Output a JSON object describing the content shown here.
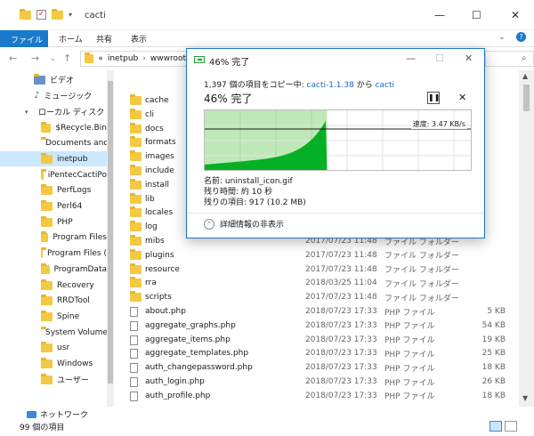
{
  "window": {
    "title": "cacti"
  },
  "ribbon": {
    "tabs": [
      "ファイル",
      "ホーム",
      "共有",
      "表示"
    ]
  },
  "address": {
    "sep": "«",
    "segments": [
      "inetpub",
      "wwwroot"
    ]
  },
  "sidebar": {
    "items": [
      {
        "label": "ビデオ",
        "icon": "video-folder-icon"
      },
      {
        "label": "ミュージック",
        "icon": "music-icon"
      },
      {
        "label": "ローカル ディスク (C",
        "icon": "drive-icon"
      },
      {
        "label": "$Recycle.Bin",
        "icon": "folder-icon"
      },
      {
        "label": "Documents and",
        "icon": "folder-icon"
      },
      {
        "label": "inetpub",
        "icon": "folder-icon"
      },
      {
        "label": "iPentecCactiPo",
        "icon": "folder-icon"
      },
      {
        "label": "PerfLogs",
        "icon": "folder-icon"
      },
      {
        "label": "Perl64",
        "icon": "folder-icon"
      },
      {
        "label": "PHP",
        "icon": "folder-icon"
      },
      {
        "label": "Program Files",
        "icon": "folder-icon"
      },
      {
        "label": "Program Files (",
        "icon": "folder-icon"
      },
      {
        "label": "ProgramData",
        "icon": "folder-icon"
      },
      {
        "label": "Recovery",
        "icon": "folder-icon"
      },
      {
        "label": "RRDTool",
        "icon": "folder-icon"
      },
      {
        "label": "Spine",
        "icon": "folder-icon"
      },
      {
        "label": "System Volume",
        "icon": "folder-icon"
      },
      {
        "label": "usr",
        "icon": "folder-icon"
      },
      {
        "label": "Windows",
        "icon": "folder-icon"
      },
      {
        "label": "ユーザー",
        "icon": "folder-icon"
      }
    ],
    "selected": "inetpub"
  },
  "files": [
    {
      "name": "cache",
      "date": "",
      "type": "",
      "size": "",
      "kind": "folder"
    },
    {
      "name": "cli",
      "date": "",
      "type": "",
      "size": "",
      "kind": "folder"
    },
    {
      "name": "docs",
      "date": "",
      "type": "",
      "size": "",
      "kind": "folder"
    },
    {
      "name": "formats",
      "date": "",
      "type": "",
      "size": "",
      "kind": "folder"
    },
    {
      "name": "images",
      "date": "",
      "type": "",
      "size": "",
      "kind": "folder"
    },
    {
      "name": "include",
      "date": "",
      "type": "",
      "size": "",
      "kind": "folder"
    },
    {
      "name": "install",
      "date": "",
      "type": "",
      "size": "",
      "kind": "folder"
    },
    {
      "name": "lib",
      "date": "",
      "type": "",
      "size": "",
      "kind": "folder"
    },
    {
      "name": "locales",
      "date": "",
      "type": "",
      "size": "",
      "kind": "folder"
    },
    {
      "name": "log",
      "date": "",
      "type": "",
      "size": "",
      "kind": "folder"
    },
    {
      "name": "mibs",
      "date": "2017/07/23 11:48",
      "type": "ファイル フォルダー",
      "size": "",
      "kind": "folder"
    },
    {
      "name": "plugins",
      "date": "2017/07/23 11:48",
      "type": "ファイル フォルダー",
      "size": "",
      "kind": "folder"
    },
    {
      "name": "resource",
      "date": "2017/07/23 11:48",
      "type": "ファイル フォルダー",
      "size": "",
      "kind": "folder"
    },
    {
      "name": "rra",
      "date": "2018/03/25 11:04",
      "type": "ファイル フォルダー",
      "size": "",
      "kind": "folder"
    },
    {
      "name": "scripts",
      "date": "2017/07/23 11:48",
      "type": "ファイル フォルダー",
      "size": "",
      "kind": "folder"
    },
    {
      "name": "about.php",
      "date": "2018/07/23 17:33",
      "type": "PHP ファイル",
      "size": "5 KB",
      "kind": "file"
    },
    {
      "name": "aggregate_graphs.php",
      "date": "2018/07/23 17:33",
      "type": "PHP ファイル",
      "size": "54 KB",
      "kind": "file"
    },
    {
      "name": "aggregate_items.php",
      "date": "2018/07/23 17:33",
      "type": "PHP ファイル",
      "size": "19 KB",
      "kind": "file"
    },
    {
      "name": "aggregate_templates.php",
      "date": "2018/07/23 17:33",
      "type": "PHP ファイル",
      "size": "25 KB",
      "kind": "file"
    },
    {
      "name": "auth_changepassword.php",
      "date": "2018/07/23 17:33",
      "type": "PHP ファイル",
      "size": "18 KB",
      "kind": "file"
    },
    {
      "name": "auth_login.php",
      "date": "2018/07/23 17:33",
      "type": "PHP ファイル",
      "size": "26 KB",
      "kind": "file"
    },
    {
      "name": "auth_profile.php",
      "date": "2018/07/23 17:33",
      "type": "PHP ファイル",
      "size": "18 KB",
      "kind": "file"
    }
  ],
  "status": {
    "network": "ネットワーク",
    "count": "99 個の項目"
  },
  "dialog": {
    "title": "46% 完了",
    "from_prefix": "1,397 個の項目をコピー中: ",
    "source": "cacti-1.1.38",
    "from_mid": " から ",
    "dest": "cacti",
    "percent_text": "46% 完了",
    "progress": 0.46,
    "speed": "速度: 3.47 KB/s",
    "name_line": "名前: uninstall_icon.gif",
    "time_line": "残り時間: 約 10 秒",
    "items_line": "残りの項目: 917 (10.2 MB)",
    "details_toggle": "詳細情報の非表示",
    "colors": {
      "fill": "#06b025",
      "fill_light": "#bfe8b8"
    }
  }
}
